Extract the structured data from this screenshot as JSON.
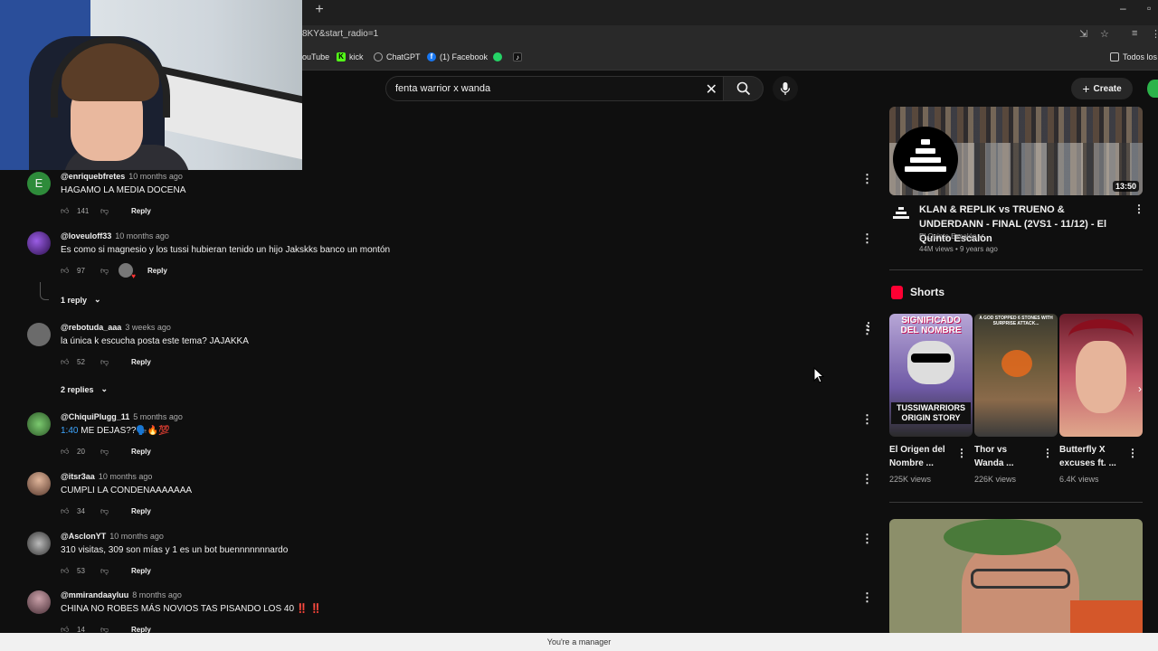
{
  "browser": {
    "new_tab": "+",
    "url": "8KY&start_radio=1",
    "bookmarks": [
      {
        "label": "ouTube",
        "icon": "youtube-icon",
        "color": "#ff0000"
      },
      {
        "label": "kick",
        "icon": "kick-icon",
        "color": "#53fc18"
      },
      {
        "label": "ChatGPT",
        "icon": "chatgpt-icon",
        "color": "#aaaaaa"
      },
      {
        "label": "(1) Facebook",
        "icon": "facebook-icon",
        "color": "#1877f2"
      },
      {
        "label": "",
        "icon": "whatsapp-icon",
        "color": "#25d366"
      },
      {
        "label": "",
        "icon": "tiktok-icon",
        "color": "#000000"
      }
    ],
    "all_bookmarks": "Todos los"
  },
  "youtube": {
    "search_value": "fenta warrior x wanda",
    "create_label": "Create"
  },
  "comments": [
    {
      "handle": "@enriquebfretes",
      "time": "10 months ago",
      "text": "HAGAMO LA MEDIA DOCENA",
      "likes": "141",
      "reply": "Reply",
      "avatar_letter": "E",
      "avatar_color": "#2e8b3a"
    },
    {
      "handle": "@loveuloff33",
      "time": "10 months ago",
      "text": "Es como si magnesio y los tussi hubieran tenido un hijo Jakskks banco un montón",
      "likes": "97",
      "reply": "Reply",
      "avatar_color": "#4b2a7a",
      "replies_toggle": "1 reply"
    },
    {
      "handle": "@rebotuda_aaa",
      "time": "3 weeks ago",
      "text": "la única k escucha posta este tema? JAJAKKA",
      "likes": "52",
      "reply": "Reply",
      "avatar_color": "#6b6b6b",
      "replies_toggle": "2 replies"
    },
    {
      "handle": "@ChiquiPlugg_11",
      "time": "5 months ago",
      "timestamp_link": "1:40",
      "text": " ME DEJAS??🗣️🔥💯",
      "likes": "20",
      "reply": "Reply",
      "avatar_color": "#3c7a3a"
    },
    {
      "handle": "@itsr3aa",
      "time": "10 months ago",
      "text": "CUMPLI LA CONDENAAAAAAA",
      "likes": "34",
      "reply": "Reply",
      "avatar_color": "#8a6a5a"
    },
    {
      "handle": "@AsclonYT",
      "time": "10 months ago",
      "text": "310 visitas, 309 son mías y 1 es un bot buennnnnnnardo",
      "likes": "53",
      "reply": "Reply",
      "avatar_color": "#555555"
    },
    {
      "handle": "@mmirandaayluu",
      "time": "8 months ago",
      "text": "CHINA NO ROBES MÁS NOVIOS TAS PISANDO LOS 40 ‼️ ‼️",
      "likes": "14",
      "reply": "Reply",
      "avatar_color": "#7a5a6a"
    }
  ],
  "sidebar": {
    "video": {
      "title": "KLAN & REPLIK vs TRUENO & UNDERDANN - FINAL (2VS1 - 11/12) - El Quinto Escalon",
      "channel": "El Quinto Escalón",
      "meta": "44M views • 9 years ago",
      "duration": "13:50"
    },
    "shorts_heading": "Shorts",
    "shorts": [
      {
        "title": "El Origen del Nombre ...",
        "views": "225K views",
        "overlay_top": "SIGNIFICADO DEL NOMBRE",
        "overlay_bottom": "TUSSIWARRIORS ORIGIN STORY"
      },
      {
        "title": "Thor vs Wanda ...",
        "views": "226K views",
        "overlay_top": "A GOD STOPPED 6 STONES WITH SURPRISE ATTACK..."
      },
      {
        "title": "Butterfly X excuses ft. ...",
        "views": "6.4K views"
      }
    ]
  },
  "status_bar": "You're a manager"
}
